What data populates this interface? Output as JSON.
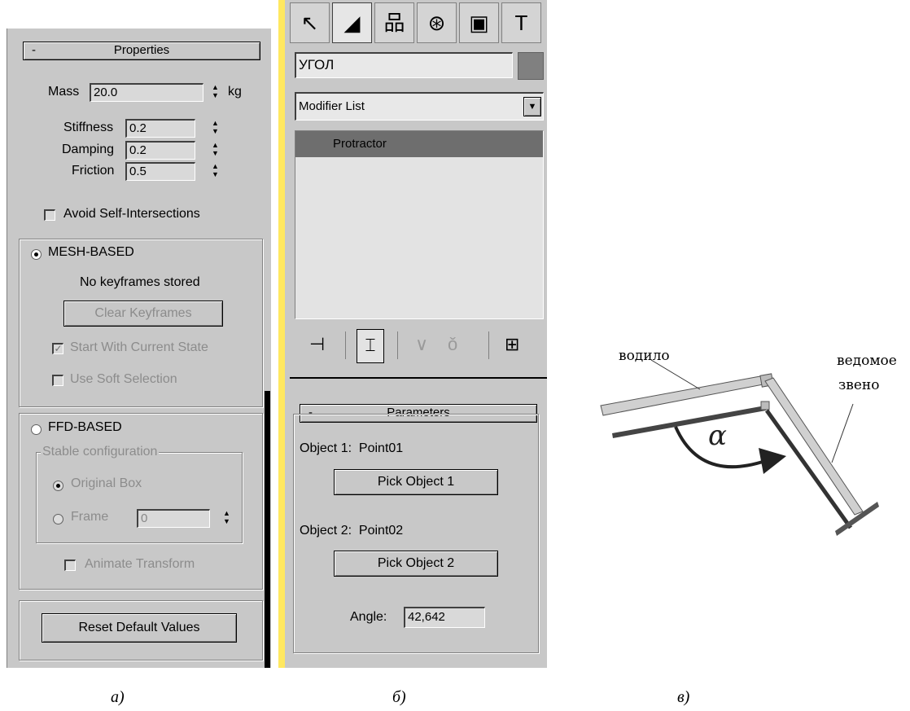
{
  "panel_a": {
    "rollout_minus": "-",
    "rollout_title": "Properties",
    "mass_label": "Mass",
    "mass_value": "20.0",
    "mass_unit": "kg",
    "stiffness_label": "Stiffness",
    "stiffness_value": "0.2",
    "damping_label": "Damping",
    "damping_value": "0.2",
    "friction_label": "Friction",
    "friction_value": "0.5",
    "avoid_label": "Avoid Self-Intersections",
    "mesh_label": "MESH-BASED",
    "no_keyframes": "No keyframes stored",
    "clear_keyframes": "Clear Keyframes",
    "start_current": "Start With Current State",
    "use_soft": "Use Soft Selection",
    "ffd_label": "FFD-BASED",
    "stable_config": "Stable configuration",
    "original_box": "Original Box",
    "frame_label": "Frame",
    "frame_value": "0",
    "animate_transform": "Animate Transform",
    "reset_defaults": "Reset Default Values"
  },
  "panel_b": {
    "object_name": "УГОЛ",
    "modifier_list": "Modifier List",
    "stack_item": "Protractor",
    "params_minus": "-",
    "params_title": "Parameters",
    "object1_label": "Object 1:",
    "object1_value": "Point01",
    "pick1": "Pick Object 1",
    "object2_label": "Object 2:",
    "object2_value": "Point02",
    "pick2": "Pick Object 2",
    "angle_label": "Angle:",
    "angle_value": "42,642"
  },
  "diagram": {
    "label_driver": "водило",
    "label_driven_1": "ведомое",
    "label_driven_2": "звено",
    "alpha": "α"
  },
  "captions": {
    "a": "а)",
    "b": "б)",
    "c": "в)"
  },
  "colors": {
    "panel_bg": "#c8c8c8",
    "selected_bg": "#6e6e6e",
    "color_swatch": "#808080",
    "accent_yellow": "#ffe860"
  }
}
